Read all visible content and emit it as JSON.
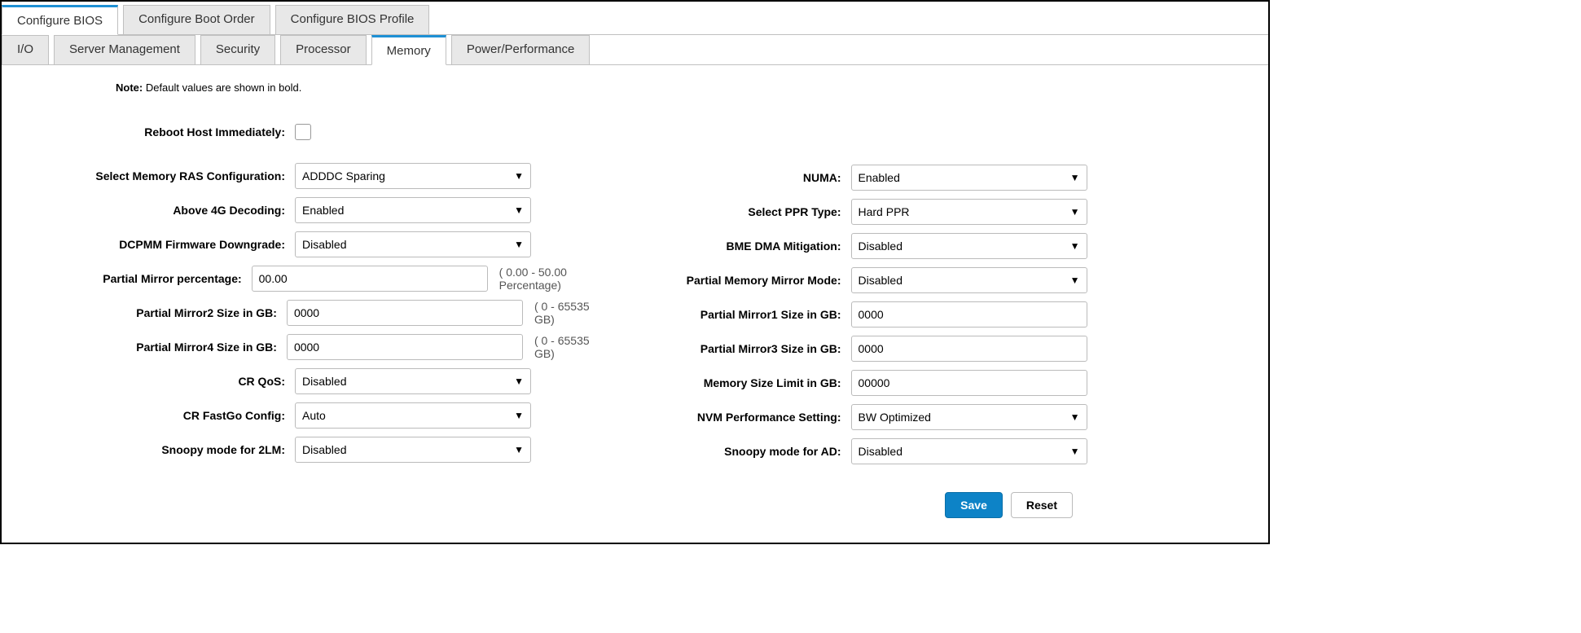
{
  "tabs_top": [
    "Configure BIOS",
    "Configure Boot Order",
    "Configure BIOS Profile"
  ],
  "tabs_top_active": 0,
  "tabs_sub": [
    "I/O",
    "Server Management",
    "Security",
    "Processor",
    "Memory",
    "Power/Performance"
  ],
  "tabs_sub_active": 4,
  "note_prefix": "Note:",
  "note_text": " Default values are shown in bold.",
  "left": {
    "reboot_label": "Reboot Host Immediately:",
    "ras_label": "Select Memory RAS Configuration:",
    "ras_value": "ADDDC Sparing",
    "above4g_label": "Above 4G Decoding:",
    "above4g_value": "Enabled",
    "dcpmm_label": "DCPMM Firmware Downgrade:",
    "dcpmm_value": "Disabled",
    "partial_pct_label": "Partial Mirror percentage:",
    "partial_pct_value": "00.00",
    "partial_pct_hint": "( 0.00 - 50.00 Percentage)",
    "pm2_label": "Partial Mirror2 Size in GB:",
    "pm2_value": "0000",
    "pm2_hint": "( 0 - 65535 GB)",
    "pm4_label": "Partial Mirror4 Size in GB:",
    "pm4_value": "0000",
    "pm4_hint": "( 0 - 65535 GB)",
    "crqos_label": "CR QoS:",
    "crqos_value": "Disabled",
    "crfast_label": "CR FastGo Config:",
    "crfast_value": "Auto",
    "snoopy2lm_label": "Snoopy mode for 2LM:",
    "snoopy2lm_value": "Disabled"
  },
  "right": {
    "numa_label": "NUMA:",
    "numa_value": "Enabled",
    "ppr_label": "Select PPR Type:",
    "ppr_value": "Hard PPR",
    "bme_label": "BME DMA Mitigation:",
    "bme_value": "Disabled",
    "pmm_label": "Partial Memory Mirror Mode:",
    "pmm_value": "Disabled",
    "pm1_label": "Partial Mirror1 Size in GB:",
    "pm1_value": "0000",
    "pm3_label": "Partial Mirror3 Size in GB:",
    "pm3_value": "0000",
    "memlimit_label": "Memory Size Limit in GB:",
    "memlimit_value": "00000",
    "nvm_label": "NVM Performance Setting:",
    "nvm_value": "BW Optimized",
    "snoopyad_label": "Snoopy mode for AD:",
    "snoopyad_value": "Disabled"
  },
  "buttons": {
    "save": "Save",
    "reset": "Reset"
  }
}
